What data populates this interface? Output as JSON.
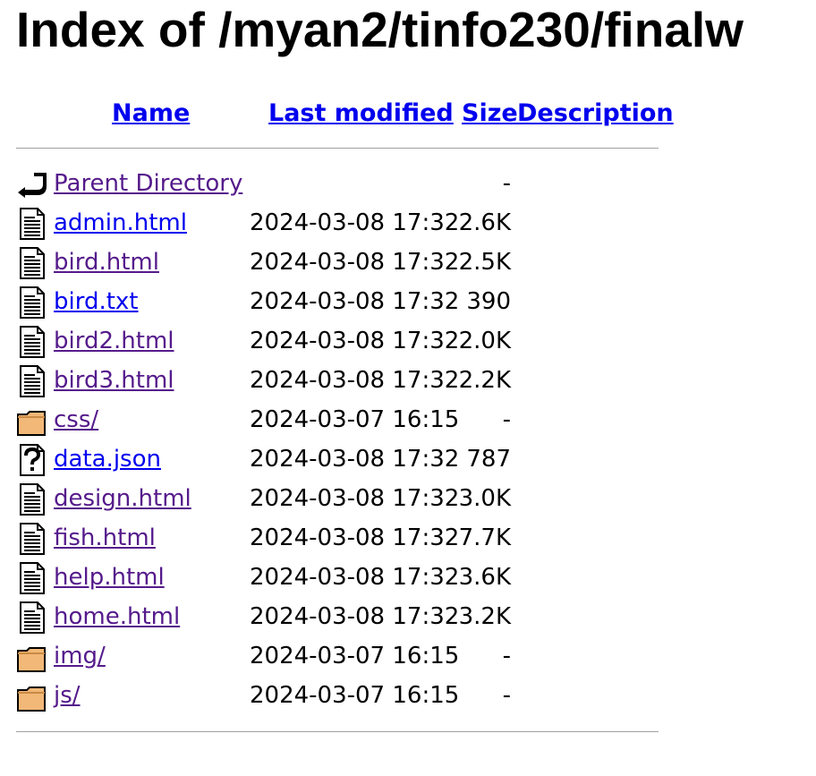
{
  "page": {
    "title": "Index of /myan2/tinfo230/finalw"
  },
  "columns": {
    "name": "Name",
    "last_modified": "Last modified",
    "size": "Size",
    "description": "Description"
  },
  "entries": [
    {
      "icon": "parent-directory-icon",
      "name": "Parent Directory",
      "modified": "",
      "size": "-",
      "visited": true
    },
    {
      "icon": "text-file-icon",
      "name": "admin.html",
      "modified": "2024-03-08 17:32",
      "size": "2.6K",
      "visited": false
    },
    {
      "icon": "text-file-icon",
      "name": "bird.html",
      "modified": "2024-03-08 17:32",
      "size": "2.5K",
      "visited": true
    },
    {
      "icon": "text-file-icon",
      "name": "bird.txt",
      "modified": "2024-03-08 17:32",
      "size": "390",
      "visited": false
    },
    {
      "icon": "text-file-icon",
      "name": "bird2.html",
      "modified": "2024-03-08 17:32",
      "size": "2.0K",
      "visited": true
    },
    {
      "icon": "text-file-icon",
      "name": "bird3.html",
      "modified": "2024-03-08 17:32",
      "size": "2.2K",
      "visited": true
    },
    {
      "icon": "folder-icon",
      "name": "css/",
      "modified": "2024-03-07 16:15",
      "size": "-",
      "visited": true
    },
    {
      "icon": "unknown-file-icon",
      "name": "data.json",
      "modified": "2024-03-08 17:32",
      "size": "787",
      "visited": false
    },
    {
      "icon": "text-file-icon",
      "name": "design.html",
      "modified": "2024-03-08 17:32",
      "size": "3.0K",
      "visited": true
    },
    {
      "icon": "text-file-icon",
      "name": "fish.html",
      "modified": "2024-03-08 17:32",
      "size": "7.7K",
      "visited": true
    },
    {
      "icon": "text-file-icon",
      "name": "help.html",
      "modified": "2024-03-08 17:32",
      "size": "3.6K",
      "visited": true
    },
    {
      "icon": "text-file-icon",
      "name": "home.html",
      "modified": "2024-03-08 17:32",
      "size": "3.2K",
      "visited": true
    },
    {
      "icon": "folder-icon",
      "name": "img/",
      "modified": "2024-03-07 16:15",
      "size": "-",
      "visited": true
    },
    {
      "icon": "folder-icon",
      "name": "js/",
      "modified": "2024-03-07 16:15",
      "size": "-",
      "visited": true
    }
  ],
  "colors": {
    "link": "#0000ee",
    "visited_link": "#551a8b",
    "folder_fill": "#f2b877",
    "rule": "#a0a0a0"
  }
}
